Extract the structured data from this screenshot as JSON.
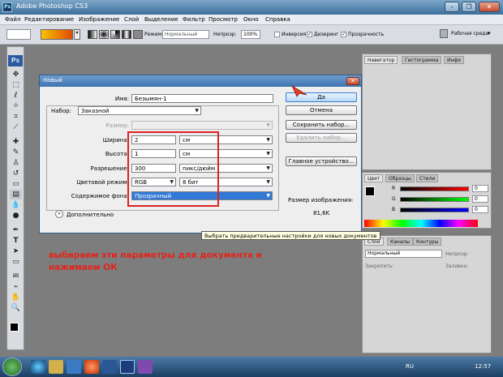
{
  "window": {
    "title": "Adobe Photoshop CS3",
    "app_icon": "Ps",
    "minimize": "–",
    "restore": "❐",
    "close": "✕"
  },
  "menu": [
    "Файл",
    "Редактирование",
    "Изображение",
    "Слой",
    "Выделение",
    "Фильтр",
    "Просмотр",
    "Окно",
    "Справка"
  ],
  "options_bar": {
    "mode_label": "Режим:",
    "mode_value": "Нормальный",
    "opacity_label": "Непрозр:",
    "opacity_value": "100%",
    "inverse_label": "Инверсия",
    "dither_label": "Дизеринг",
    "transparency_label": "Прозрачность",
    "workspace_label": "Рабочая среда"
  },
  "dialog": {
    "title": "Новый",
    "name_label": "Имя:",
    "name_value": "Безымян-1",
    "preset_label": "Набор:",
    "preset_value": "Заказной",
    "size_label": "Размер:",
    "width_label": "Ширина:",
    "width_value": "2",
    "width_unit": "см",
    "height_label": "Высота:",
    "height_value": "1",
    "height_unit": "см",
    "resolution_label": "Разрешение:",
    "resolution_value": "300",
    "resolution_unit": "пикс/дюйм",
    "color_mode_label": "Цветовой режим:",
    "color_mode_value": "RGB",
    "bit_depth_value": "8 бит",
    "background_label": "Содержимое фона:",
    "background_value": "Прозрачный",
    "advanced_label": "Дополнительно",
    "ok_label": "Да",
    "cancel_label": "Отмена",
    "save_preset_label": "Сохранить набор...",
    "delete_preset_label": "Удалить набор...",
    "device_central_label": "Главное устройство...",
    "image_size_label": "Размер изображения:",
    "image_size_value": "81,6K"
  },
  "tooltip": "Выбрать предварительные настройки для новых документов",
  "annotation": "выбираем эти параметры для документа и нажимаем ОК",
  "panels": {
    "navigator_tabs": [
      "Навигатор",
      "Гистограмма",
      "Инфо"
    ],
    "color_tabs": [
      "Цвет",
      "Образцы",
      "Стили"
    ],
    "color_channels": [
      "R",
      "G",
      "B"
    ],
    "color_values": [
      "0",
      "0",
      "0"
    ],
    "layers_tabs": [
      "Слои",
      "Каналы",
      "Контуры"
    ],
    "layers_mode": "Нормальный",
    "layers_opacity_label": "Непрозр:",
    "layers_lock_label": "Закрепить:",
    "layers_fill_label": "Заливка:"
  },
  "taskbar": {
    "language": "RU",
    "clock": "12:57"
  },
  "colors": {
    "annotation": "#e3241b",
    "highlight_box": "#dd2222",
    "selected_field": "#3179d6"
  }
}
